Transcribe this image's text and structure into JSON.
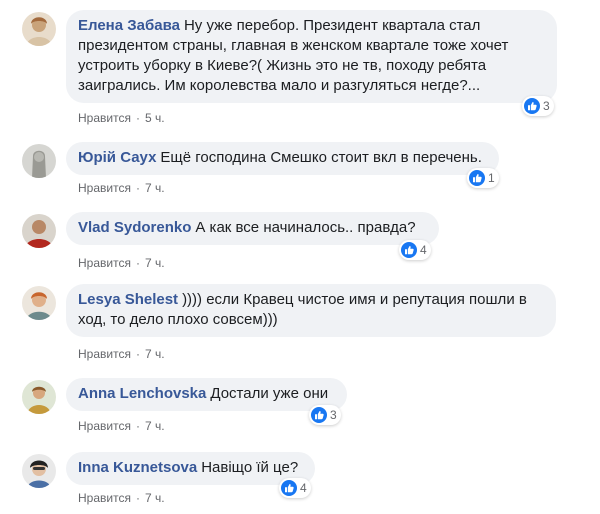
{
  "comments": [
    {
      "author": "Елена Забава",
      "text": "Ну уже перебор. Президент квартала стал президентом страны, главная в женском квартале тоже хочет устроить уборку в Киеве?( Жизнь это не тв, походу ребята заигрались. Им королевства мало и разгуляться негде?...",
      "like_label": "Нравится",
      "separator": "·",
      "time": "5 ч.",
      "reaction_icon": "like-icon",
      "reactions": "3"
    },
    {
      "author": "Юрій Саух",
      "text": "Ещё господина Смешко стоит вкл в перечень.",
      "like_label": "Нравится",
      "separator": "·",
      "time": "7 ч.",
      "reaction_icon": "like-icon",
      "reactions": "1"
    },
    {
      "author": "Vlad Sydorenko",
      "text": "А как все начиналось.. правда?",
      "like_label": "Нравится",
      "separator": "·",
      "time": "7 ч.",
      "reaction_icon": "like-icon",
      "reactions": "4"
    },
    {
      "author": "Lesya Shelest",
      "text": ")))) если Кравец чистое имя и репутация пошли в ход, то дело плохо совсем)))",
      "like_label": "Нравится",
      "separator": "·",
      "time": "7 ч.",
      "reaction_icon": "like-icon",
      "reactions": ""
    },
    {
      "author": "Anna Lenchovska",
      "text": "Достали уже они",
      "like_label": "Нравится",
      "separator": "·",
      "time": "7 ч.",
      "reaction_icon": "like-icon",
      "reactions": "3"
    },
    {
      "author": "Inna Kuznetsova",
      "text": "Навіщо їй це?",
      "like_label": "Нравится",
      "separator": "·",
      "time": "7 ч.",
      "reaction_icon": "like-icon",
      "reactions": "4"
    }
  ],
  "colors": {
    "author": "#385898",
    "bubble": "#f0f2f5",
    "like_badge": "#1877f2",
    "meta": "#65676b"
  }
}
